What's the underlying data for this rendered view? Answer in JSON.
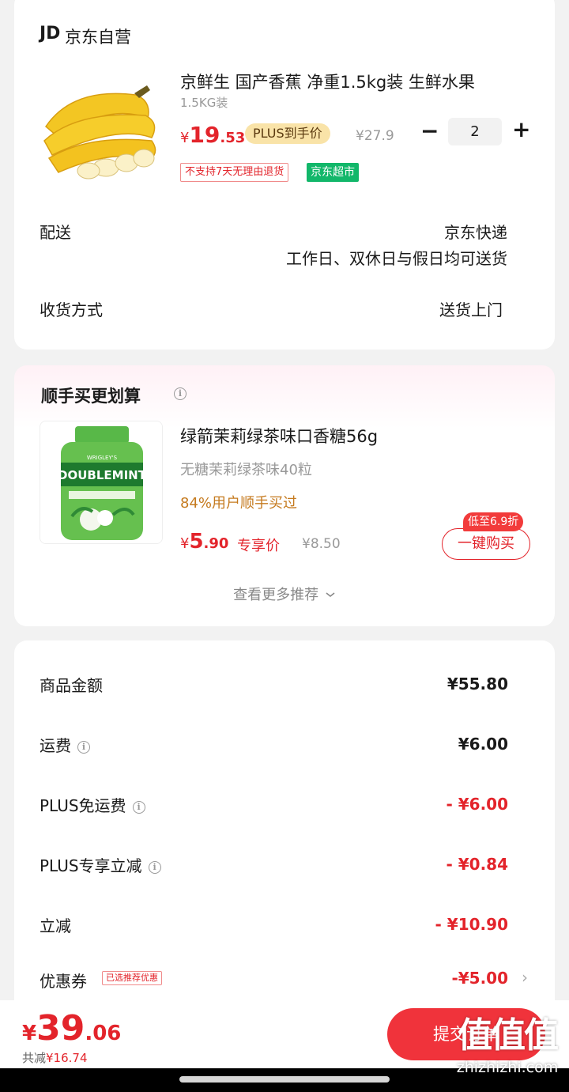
{
  "shop": {
    "logo": "JD",
    "name": "京东自营"
  },
  "product": {
    "title": "京鲜生 国产香蕉 净重1.5kg装 生鲜水果",
    "spec": "1.5KG装",
    "price_currency": "¥",
    "price_int": "19",
    "price_dec": ".53",
    "plus_tag": "PLUS到手价",
    "orig_price": "¥27.9",
    "qty_minus": "−",
    "quantity": "2",
    "qty_plus": "+",
    "tags": [
      "不支持7天无理由退货",
      "京东超市"
    ]
  },
  "delivery": {
    "label": "配送",
    "service": "京东快递",
    "schedule": "工作日、双休日与假日均可送货",
    "method_label": "收货方式",
    "method_value": "送货上门"
  },
  "addon": {
    "title": "顺手买更划算",
    "item": {
      "name": "绿箭茉莉绿茶味口香糖56g",
      "subtitle": "无糖茉莉绿茶味40粒",
      "popularity": "84%用户顺手买过",
      "price_currency": "¥",
      "price_int": "5",
      "price_dec": ".90",
      "exclusive_label": "专享价",
      "orig_price": "¥8.50",
      "discount_badge": "低至6.9折",
      "buy_button": "一键购买",
      "image_brand": "DOUBLEMINT",
      "image_maker": "WRIGLEY'S"
    },
    "more_link": "查看更多推荐"
  },
  "summary": {
    "rows": [
      {
        "label": "商品金额",
        "value": "¥55.80"
      },
      {
        "label": "运费",
        "value": "¥6.00"
      },
      {
        "label": "PLUS免运费",
        "value": "- ¥6.00"
      },
      {
        "label": "PLUS专享立减",
        "value": "- ¥0.84"
      },
      {
        "label": "立减",
        "value": "- ¥10.90"
      },
      {
        "label": "优惠券",
        "value": "-¥5.00",
        "tag": "已选推荐优惠"
      }
    ]
  },
  "footer": {
    "total_currency": "¥",
    "total_int": "39",
    "total_dec": ".06",
    "saved_label": "共减",
    "saved_value": "¥16.74",
    "submit_button": "提交订单"
  },
  "watermark": {
    "logo": "值值值",
    "url": "zhizhizhi.com"
  },
  "colors": {
    "accent": "#e3242b",
    "plus_tag_bg": "#f9e3a8",
    "supermarket_green": "#12b76a",
    "popularity_orange": "#c57a1e"
  }
}
